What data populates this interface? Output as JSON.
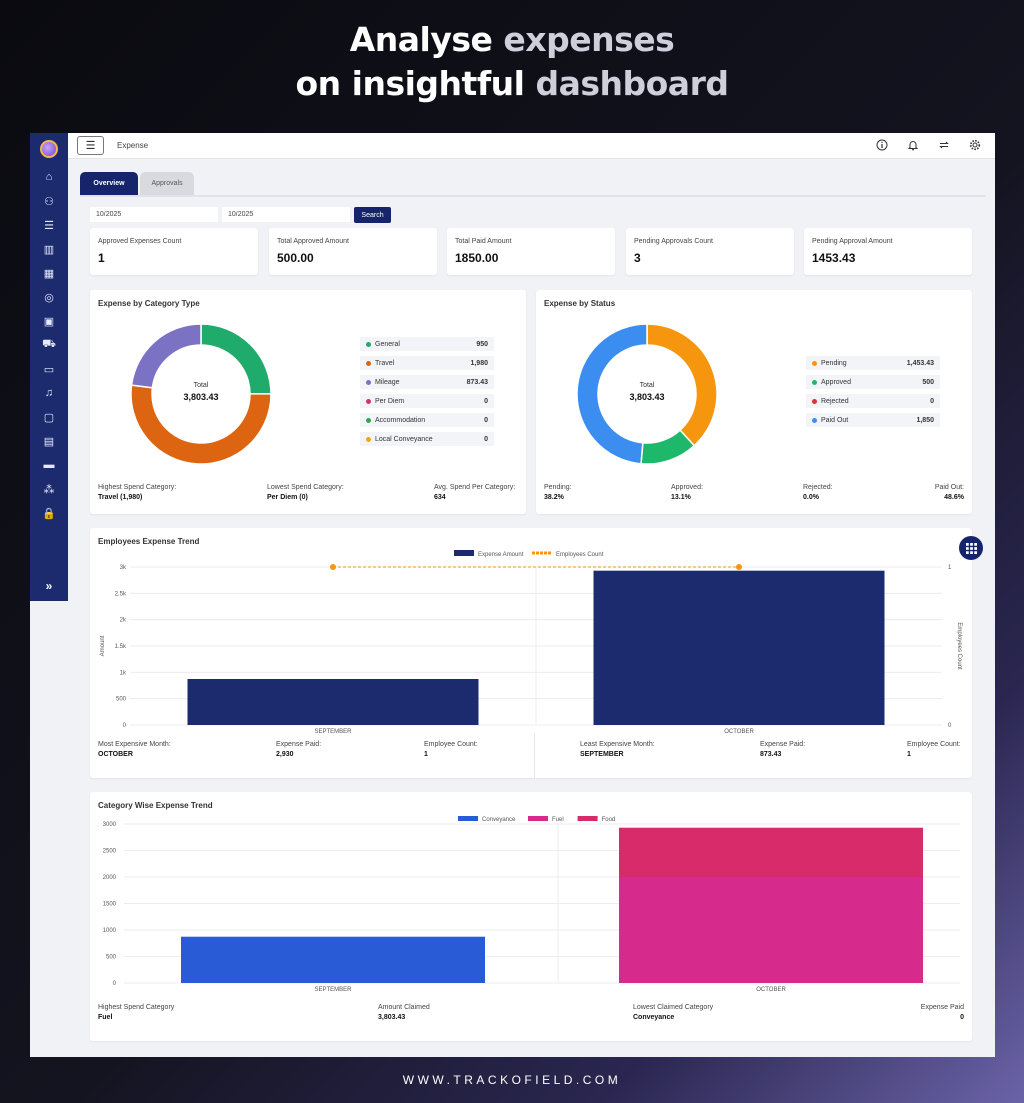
{
  "hero": {
    "line1_a": "Analyse",
    "line1_b": "expenses",
    "line2_a": "on insightful",
    "line2_b": "dashboard"
  },
  "footer_url": "WWW.TRACKOFIELD.COM",
  "topbar": {
    "breadcrumb": "Expense",
    "icons": [
      "info-icon",
      "bell-icon",
      "sync-icon",
      "gear-icon"
    ]
  },
  "sidebar": {
    "icons": [
      "home-icon",
      "team-icon",
      "tasks-icon",
      "chart-icon",
      "calendar-icon",
      "target-icon",
      "bag-icon",
      "cart-icon",
      "card-icon",
      "bell-icon",
      "briefcase-icon",
      "clipboard-icon",
      "cash-icon",
      "hierarchy-icon",
      "lock-icon"
    ],
    "expand": "»"
  },
  "tabs": [
    {
      "label": "Overview",
      "active": true
    },
    {
      "label": "Approvals",
      "active": false
    }
  ],
  "filters": {
    "from": "10/2025",
    "to": "10/2025",
    "search_label": "Search"
  },
  "kpis": [
    {
      "label": "Approved Expenses Count",
      "value": "1"
    },
    {
      "label": "Total Approved Amount",
      "value": "500.00"
    },
    {
      "label": "Total Paid Amount",
      "value": "1850.00"
    },
    {
      "label": "Pending Approvals Count",
      "value": "3"
    },
    {
      "label": "Pending Approval Amount",
      "value": "1453.43"
    }
  ],
  "category_card": {
    "title": "Expense by Category Type",
    "total_label": "Total",
    "total_value": "3,803.43",
    "items": [
      {
        "name": "General",
        "value": "950",
        "color": "#1fab6b"
      },
      {
        "name": "Travel",
        "value": "1,980",
        "color": "#dd6410"
      },
      {
        "name": "Mileage",
        "value": "873.43",
        "color": "#7b72c4"
      },
      {
        "name": "Per Diem",
        "value": "0",
        "color": "#d6336c"
      },
      {
        "name": "Accommodation",
        "value": "0",
        "color": "#2fa84f"
      },
      {
        "name": "Local Conveyance",
        "value": "0",
        "color": "#f2a516"
      }
    ],
    "stats": [
      {
        "label": "Highest Spend Category:",
        "value": "Travel (1,980)"
      },
      {
        "label": "Lowest Spend Category:",
        "value": "Per Diem (0)"
      },
      {
        "label": "Avg. Spend Per Category:",
        "value": "634"
      }
    ]
  },
  "status_card": {
    "title": "Expense by Status",
    "total_label": "Total",
    "total_value": "3,803.43",
    "items": [
      {
        "name": "Pending",
        "value": "1,453.43",
        "color": "#f5960e"
      },
      {
        "name": "Approved",
        "value": "500",
        "color": "#1db86a"
      },
      {
        "name": "Rejected",
        "value": "0",
        "color": "#e03131"
      },
      {
        "name": "Paid Out",
        "value": "1,850",
        "color": "#3b8ef0"
      }
    ],
    "stats": [
      {
        "label": "Pending:",
        "value": "38.2%"
      },
      {
        "label": "Approved:",
        "value": "13.1%"
      },
      {
        "label": "Rejected:",
        "value": "0.0%"
      },
      {
        "label": "Paid Out:",
        "value": "48.6%"
      }
    ]
  },
  "trend_card": {
    "title": "Employees Expense Trend",
    "stats_left": [
      {
        "label": "Most Expensive Month:",
        "value": "OCTOBER"
      },
      {
        "label": "Expense Paid:",
        "value": "2,930"
      },
      {
        "label": "Employee Count:",
        "value": "1"
      }
    ],
    "stats_right": [
      {
        "label": "Least Expensive Month:",
        "value": "SEPTEMBER"
      },
      {
        "label": "Expense Paid:",
        "value": "873.43"
      },
      {
        "label": "Employee Count:",
        "value": "1"
      }
    ]
  },
  "category_trend_card": {
    "title": "Category Wise Expense Trend",
    "stats": [
      {
        "label": "Highest Spend Category",
        "value": "Fuel"
      },
      {
        "label": "Amount Claimed",
        "value": "3,803.43"
      },
      {
        "label": "Lowest Claimed Category",
        "value": "Conveyance"
      },
      {
        "label": "Expense Paid",
        "value": "0"
      }
    ]
  },
  "chart_data": [
    {
      "type": "pie",
      "title": "Expense by Category Type",
      "categories": [
        "General",
        "Travel",
        "Mileage",
        "Per Diem",
        "Accommodation",
        "Local Conveyance"
      ],
      "values": [
        950,
        1980,
        873.43,
        0,
        0,
        0
      ],
      "colors": [
        "#1fab6b",
        "#dd6410",
        "#7b72c4",
        "#d6336c",
        "#2fa84f",
        "#f2a516"
      ]
    },
    {
      "type": "pie",
      "title": "Expense by Status",
      "categories": [
        "Pending",
        "Approved",
        "Rejected",
        "Paid Out"
      ],
      "values": [
        1453.43,
        500,
        0,
        1850
      ],
      "colors": [
        "#f5960e",
        "#1db86a",
        "#e03131",
        "#3b8ef0"
      ]
    },
    {
      "type": "bar",
      "title": "Employees Expense Trend",
      "categories": [
        "SEPTEMBER",
        "OCTOBER"
      ],
      "series": [
        {
          "name": "Expense Amount",
          "values": [
            873.43,
            2930
          ],
          "color": "#1c2a6e"
        },
        {
          "name": "Employees Count",
          "values": [
            1,
            1
          ],
          "color": "#f5960e",
          "kind": "line"
        }
      ],
      "ylabel": "Amount",
      "y2label": "Employees Count",
      "ylim": [
        0,
        3000
      ],
      "y2lim": [
        0,
        1
      ],
      "yticks": [
        "0",
        "500",
        "1k",
        "1.5k",
        "2k",
        "2.5k",
        "3k"
      ],
      "y2ticks": [
        "0",
        "1"
      ],
      "legend": "top"
    },
    {
      "type": "bar",
      "title": "Category Wise Expense Trend",
      "categories": [
        "SEPTEMBER",
        "OCTOBER"
      ],
      "stacked": true,
      "series": [
        {
          "name": "Conveyance",
          "values": [
            873.43,
            0
          ],
          "color": "#2a5bd7"
        },
        {
          "name": "Fuel",
          "values": [
            0,
            2000
          ],
          "color": "#d62a8c"
        },
        {
          "name": "Food",
          "values": [
            0,
            930
          ],
          "color": "#d82c6a"
        }
      ],
      "ylim": [
        0,
        3000
      ],
      "yticks": [
        "0",
        "500",
        "1000",
        "1500",
        "2000",
        "2500",
        "3000"
      ],
      "legend": "top"
    }
  ]
}
